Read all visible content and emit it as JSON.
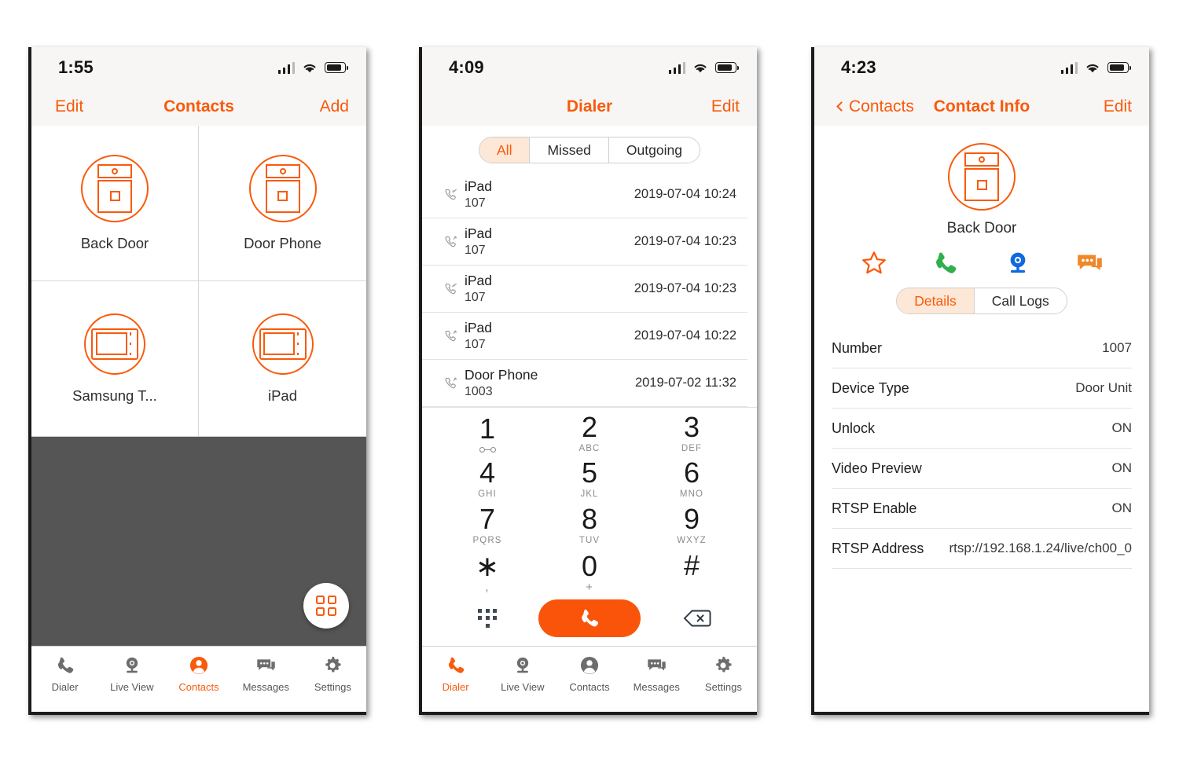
{
  "theme": {
    "accent": "#F95A0B",
    "accent_soft": "#FDE7D6",
    "green": "#30B04A",
    "blue": "#1068E0",
    "gray_panel": "#555555"
  },
  "phone_contacts": {
    "status": {
      "time": "1:55",
      "signal_icon": "signal-bars-icon",
      "wifi_icon": "wifi-icon",
      "battery_icon": "battery-icon"
    },
    "nav": {
      "left": "Edit",
      "title": "Contacts",
      "right": "Add"
    },
    "contacts": [
      {
        "name": "Back Door",
        "icon": "door-unit-icon"
      },
      {
        "name": "Door Phone",
        "icon": "door-unit-icon"
      },
      {
        "name": "Samsung T...",
        "icon": "tablet-icon"
      },
      {
        "name": "iPad",
        "icon": "tablet-icon"
      }
    ],
    "fab_icon": "grid-four-icon",
    "tabs": [
      {
        "label": "Dialer",
        "icon": "phone-handset-icon",
        "active": false
      },
      {
        "label": "Live View",
        "icon": "webcam-icon",
        "active": false
      },
      {
        "label": "Contacts",
        "icon": "person-circle-icon",
        "active": true
      },
      {
        "label": "Messages",
        "icon": "chat-bubble-icon",
        "active": false
      },
      {
        "label": "Settings",
        "icon": "gear-icon",
        "active": false
      }
    ]
  },
  "phone_dialer": {
    "status": {
      "time": "4:09"
    },
    "nav": {
      "left": "",
      "title": "Dialer",
      "right": "Edit"
    },
    "filters": [
      {
        "label": "All",
        "selected": true
      },
      {
        "label": "Missed",
        "selected": false
      },
      {
        "label": "Outgoing",
        "selected": false
      }
    ],
    "call_log": [
      {
        "name": "iPad",
        "number": "107",
        "time": "2019-07-04 10:24",
        "direction": "incoming"
      },
      {
        "name": "iPad",
        "number": "107",
        "time": "2019-07-04 10:23",
        "direction": "outgoing"
      },
      {
        "name": "iPad",
        "number": "107",
        "time": "2019-07-04 10:23",
        "direction": "incoming"
      },
      {
        "name": "iPad",
        "number": "107",
        "time": "2019-07-04 10:22",
        "direction": "outgoing"
      },
      {
        "name": "Door Phone",
        "number": "1003",
        "time": "2019-07-02 11:32",
        "direction": "outgoing"
      }
    ],
    "keypad": [
      {
        "digit": "1",
        "sub": "",
        "sub_icon": "voicemail-icon"
      },
      {
        "digit": "2",
        "sub": "ABC"
      },
      {
        "digit": "3",
        "sub": "DEF"
      },
      {
        "digit": "4",
        "sub": "GHI"
      },
      {
        "digit": "5",
        "sub": "JKL"
      },
      {
        "digit": "6",
        "sub": "MNO"
      },
      {
        "digit": "7",
        "sub": "PQRS"
      },
      {
        "digit": "8",
        "sub": "TUV"
      },
      {
        "digit": "9",
        "sub": "WXYZ"
      },
      {
        "digit": "∗",
        "sub": ","
      },
      {
        "digit": "0",
        "sub": "+"
      },
      {
        "digit": "#",
        "sub": ""
      }
    ],
    "keypad_toggle_icon": "keypad-dots-icon",
    "call_button_icon": "phone-handset-icon",
    "delete_icon": "backspace-icon",
    "tabs": [
      {
        "label": "Dialer",
        "icon": "phone-handset-icon",
        "active": true
      },
      {
        "label": "Live View",
        "icon": "webcam-icon",
        "active": false
      },
      {
        "label": "Contacts",
        "icon": "person-circle-icon",
        "active": false
      },
      {
        "label": "Messages",
        "icon": "chat-bubble-icon",
        "active": false
      },
      {
        "label": "Settings",
        "icon": "gear-icon",
        "active": false
      }
    ]
  },
  "phone_contact_info": {
    "status": {
      "time": "4:23"
    },
    "nav": {
      "back": "Contacts",
      "title": "Contact Info",
      "right": "Edit"
    },
    "contact": {
      "name": "Back Door",
      "icon": "door-unit-icon"
    },
    "actions": [
      {
        "name": "favorite",
        "icon": "star-outline-icon"
      },
      {
        "name": "call",
        "icon": "phone-handset-icon"
      },
      {
        "name": "live-view",
        "icon": "webcam-icon"
      },
      {
        "name": "message",
        "icon": "chat-bubble-icon"
      }
    ],
    "tabs": [
      {
        "label": "Details",
        "selected": true
      },
      {
        "label": "Call Logs",
        "selected": false
      }
    ],
    "details": [
      {
        "key": "Number",
        "value": "1007"
      },
      {
        "key": "Device Type",
        "value": "Door Unit"
      },
      {
        "key": "Unlock",
        "value": "ON"
      },
      {
        "key": "Video Preview",
        "value": "ON"
      },
      {
        "key": "RTSP Enable",
        "value": "ON"
      },
      {
        "key": "RTSP Address",
        "value": "rtsp://192.168.1.24/live/ch00_0"
      }
    ]
  }
}
